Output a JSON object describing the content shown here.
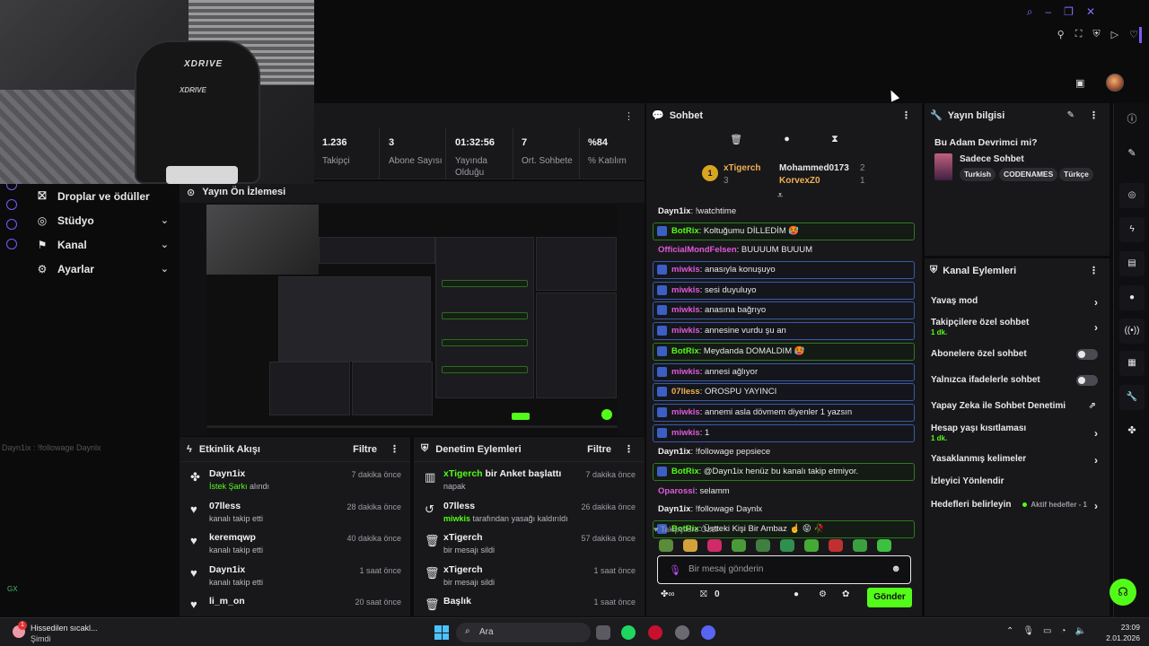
{
  "window": {
    "controls": [
      "search-icon",
      "minimize-icon",
      "restore-icon",
      "close-icon"
    ],
    "toolbar_icons": [
      "pin-icon",
      "crop-icon",
      "shield-icon",
      "play-icon",
      "heart-icon"
    ]
  },
  "webcam": {
    "chair_brand": "XDRIVE"
  },
  "sidebar": {
    "items": [
      {
        "label": "Droplar ve ödüller",
        "icon": "gift-icon",
        "chevron": false
      },
      {
        "label": "Stüdyo",
        "icon": "studio-icon",
        "chevron": true
      },
      {
        "label": "Kanal",
        "icon": "channel-icon",
        "chevron": true
      },
      {
        "label": "Ayarlar",
        "icon": "gear-icon",
        "chevron": true
      }
    ],
    "ghost_chat": "Dayn1ix : !followage Daynlx",
    "gx_label": "GX"
  },
  "stats": [
    {
      "value": "1.236",
      "label": "Takipçi"
    },
    {
      "value": "3",
      "label": "Abone Sayısı"
    },
    {
      "value": "01:32:56",
      "label": "Yayında Olduğu"
    },
    {
      "value": "7",
      "label": "Ort. Sohbete"
    },
    {
      "value": "%84",
      "label": "% Katılım"
    }
  ],
  "preview": {
    "title": "Yayın Ön İzlemesi"
  },
  "activity": {
    "title": "Etkinlik Akışı",
    "filter": "Filtre",
    "items": [
      {
        "icon": "kick-icon",
        "user": "Dayn1ix",
        "sub_highlight": "İstek Şarkı",
        "sub": "alındı",
        "time": "7 dakika önce"
      },
      {
        "icon": "heart-icon",
        "user": "07lless",
        "sub_highlight": "",
        "sub": "kanalı takip etti",
        "time": "28 dakika önce"
      },
      {
        "icon": "heart-icon",
        "user": "keremqwp",
        "sub_highlight": "",
        "sub": "kanalı takip etti",
        "time": "40 dakika önce"
      },
      {
        "icon": "heart-icon",
        "user": "Dayn1ix",
        "sub_highlight": "",
        "sub": "kanalı takip etti",
        "time": "1 saat önce"
      },
      {
        "icon": "heart-icon",
        "user": "li_m_on",
        "sub_highlight": "",
        "sub": "",
        "time": "20 saat önce"
      }
    ]
  },
  "moderation": {
    "title": "Denetim Eylemleri",
    "filter": "Filtre",
    "items": [
      {
        "icon": "poll-icon",
        "user": "xTigerch",
        "action": "bir Anket başlattı",
        "sub_highlight": "",
        "sub": "napak",
        "time": "7 dakika önce"
      },
      {
        "icon": "undo-icon",
        "user": "07lless",
        "action": "",
        "sub_highlight": "miwkis",
        "sub": "tarafından yasağı kaldırıldı",
        "time": "26 dakika önce"
      },
      {
        "icon": "trash-icon",
        "user": "xTigerch",
        "action": "",
        "sub_highlight": "",
        "sub": "bir mesajı sildi",
        "time": "57 dakika önce"
      },
      {
        "icon": "trash-icon",
        "user": "xTigerch",
        "action": "",
        "sub_highlight": "",
        "sub": "bir mesajı sildi",
        "time": "1 saat önce"
      },
      {
        "icon": "trash-icon",
        "user": "Başlık",
        "action": "",
        "sub_highlight": "",
        "sub": "",
        "time": "1 saat önce"
      }
    ]
  },
  "chat": {
    "title": "Sohbet",
    "tools": [
      "trash-icon",
      "chat-icon",
      "hourglass-icon"
    ],
    "leaderboard": {
      "first": {
        "rank": "1",
        "name": "xTigerch",
        "count": "3"
      },
      "second": {
        "name": "Mohammed0173",
        "count": "2"
      },
      "third": {
        "name": "KorvexZ0",
        "count": "1"
      }
    },
    "messages": [
      {
        "user": "Dayn1ix",
        "text": "!watchtime",
        "style": "plain",
        "color": "white"
      },
      {
        "user": "BotRix",
        "text": "Koltuğumu DİLLEDİM 🥵",
        "style": "bot",
        "color": "green"
      },
      {
        "user": "OfficialMondFelsen",
        "text": "BUUUUM BUUUM",
        "style": "plain",
        "color": "pink"
      },
      {
        "user": "miwkis",
        "text": "anasıyla konuşuyo",
        "style": "mod",
        "color": "pink"
      },
      {
        "user": "miwkis",
        "text": "sesi duyuluyo",
        "style": "mod",
        "color": "pink"
      },
      {
        "user": "miwkis",
        "text": "anasına bağrıyo",
        "style": "mod",
        "color": "pink"
      },
      {
        "user": "miwkis",
        "text": "annesine vurdu şu an",
        "style": "mod",
        "color": "pink"
      },
      {
        "user": "BotRix",
        "text": "Meydanda DOMALDIM 🥵",
        "style": "bot",
        "color": "green"
      },
      {
        "user": "miwkis",
        "text": "annesi ağlıyor",
        "style": "mod",
        "color": "pink"
      },
      {
        "user": "07lless",
        "text": "OROSPU YAYINCI",
        "style": "mod",
        "color": "orange"
      },
      {
        "user": "miwkis",
        "text": "annemi asla dövmem diyenler 1 yazsın",
        "style": "mod",
        "color": "pink"
      },
      {
        "user": "miwkis",
        "text": "1",
        "style": "mod",
        "color": "pink"
      },
      {
        "user": "Dayn1ix",
        "text": "!followage pepsiece",
        "style": "plain",
        "color": "white"
      },
      {
        "user": "BotRix",
        "text": "@Dayn1ix henüz bu kanalı takip etmiyor.",
        "style": "bot",
        "color": "green"
      },
      {
        "user": "Oparossi",
        "text": "selamm",
        "style": "plain",
        "color": "pink"
      },
      {
        "user": "Dayn1ix",
        "text": "!followage Daynlx",
        "style": "plain",
        "color": "white"
      },
      {
        "user": "BotRix",
        "text": "Üstteki Kişi Bir Ambaz ☝️ 😝 🥀",
        "style": "bot",
        "color": "green"
      }
    ],
    "emote_label": "Takipçilere Özel",
    "emote_colors": [
      "#5b8c3a",
      "#d4a23a",
      "#d12a6a",
      "#4a9a3a",
      "#3f7f3f",
      "#2f8f4f",
      "#44aa33",
      "#c03030",
      "#3aa040",
      "#3cc040"
    ],
    "input_placeholder": "Bir mesaj gönderin",
    "bottom_count": "0",
    "send_label": "Gönder"
  },
  "stream_info": {
    "title": "Yayın bilgisi",
    "stream_title": "Bu Adam Devrimci mi?",
    "category": "Sadece Sohbet",
    "tags": [
      "Turkish",
      "CODENAMES",
      "Türkçe"
    ]
  },
  "channel_actions": {
    "title": "Kanal Eylemleri",
    "items": [
      {
        "label": "Yavaş mod",
        "sub": "",
        "control": "arrow"
      },
      {
        "label": "Takipçilere özel sohbet",
        "sub": "1 dk.",
        "control": "arrow"
      },
      {
        "label": "Abonelere özel sohbet",
        "sub": "",
        "control": "toggle"
      },
      {
        "label": "Yalnızca ifadelerle sohbet",
        "sub": "",
        "control": "toggle"
      },
      {
        "label": "Yapay Zeka ile Sohbet Denetimi",
        "sub": "",
        "control": "external"
      },
      {
        "label": "Hesap yaşı kısıtlaması",
        "sub": "1 dk.",
        "control": "arrow"
      },
      {
        "label": "Yasaklanmış kelimeler",
        "sub": "",
        "control": "arrow"
      },
      {
        "label": "İzleyici Yönlendir",
        "sub": "",
        "control": "none"
      },
      {
        "label": "Hedefleri belirleyin",
        "sub": "",
        "control": "arrow",
        "active_label": "Aktif hedefler - 1"
      }
    ]
  },
  "right_rail": [
    "info-icon",
    "pencil-icon",
    "target-icon",
    "lightning-icon",
    "document-icon",
    "chat-bubble-icon",
    "broadcast-icon",
    "layout-icon",
    "wrench-icon",
    "kick-icon"
  ],
  "taskbar": {
    "weather_text": "Hissedilen sıcakl...",
    "weather_sub": "Şimdi",
    "weather_badge": "1",
    "search_label": "Ara",
    "time": "23:09",
    "date": "2.01.2026"
  }
}
